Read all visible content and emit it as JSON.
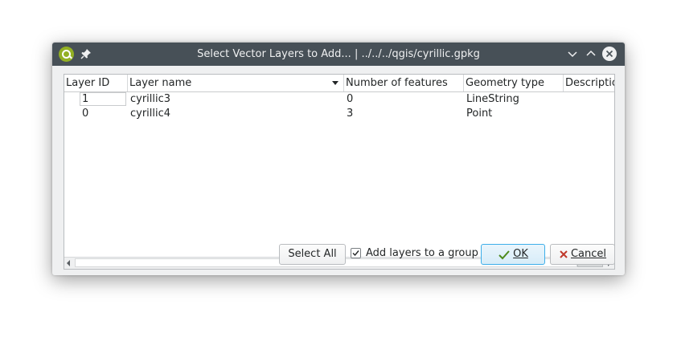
{
  "window": {
    "title": "Select Vector Layers to Add... | ../../../qgis/cyrillic.gpkg",
    "app_icon": "qgis-logo-icon",
    "pin_icon": "pin-icon"
  },
  "table": {
    "columns": [
      {
        "label": "Layer ID"
      },
      {
        "label": "Layer name",
        "sorted": "descending"
      },
      {
        "label": "Number of features"
      },
      {
        "label": "Geometry type"
      },
      {
        "label": "Descriptio"
      }
    ],
    "rows": [
      {
        "layer_id": "1",
        "layer_name": "cyrillic3",
        "features": "0",
        "geometry": "LineString",
        "description": ""
      },
      {
        "layer_id": "0",
        "layer_name": "cyrillic4",
        "features": "3",
        "geometry": "Point",
        "description": ""
      }
    ]
  },
  "buttons": {
    "select_all": "Select All",
    "ok": "OK",
    "cancel": "Cancel"
  },
  "add_to_group": {
    "label": "Add layers to a group",
    "checked": true
  },
  "colors": {
    "titlebar": "#475057",
    "dialog_bg": "#eff0f1",
    "ok_focus": "#3daee9"
  }
}
